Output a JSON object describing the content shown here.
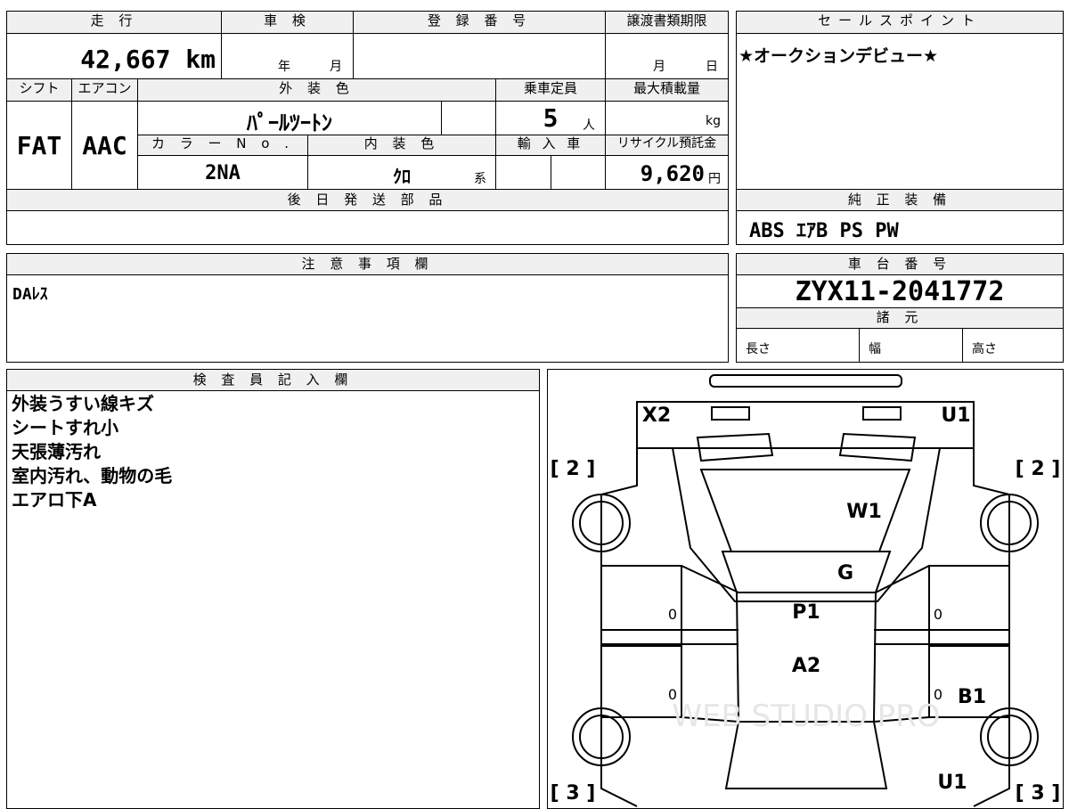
{
  "vehicle": {
    "mileage": {
      "label": "走 行",
      "value": "42,667 km"
    },
    "inspection": {
      "label": "車 検",
      "year_unit": "年",
      "month_unit": "月"
    },
    "registration": {
      "label": "登 録 番 号",
      "value": ""
    },
    "transfer_deadline": {
      "label": "譲渡書類期限",
      "month_unit": "月",
      "day_unit": "日"
    },
    "shift": {
      "label": "シフト",
      "value": "FAT"
    },
    "aircon": {
      "label": "エアコン",
      "value": "AAC"
    },
    "exterior_color": {
      "label": "外 装 色",
      "value": "ﾊﾟｰﾙﾂｰﾄﾝ"
    },
    "capacity": {
      "label": "乗車定員",
      "value": "5",
      "unit": "人"
    },
    "max_load": {
      "label": "最大積載量",
      "unit": "kg"
    },
    "color_no": {
      "label": "カ ラ ー N o .",
      "value": "2NA"
    },
    "interior_color": {
      "label": "内 装 色",
      "value": "ｸﾛ",
      "unit": "系"
    },
    "import": {
      "label": "輸 入 車"
    },
    "recycle_fee": {
      "label": "リサイクル預託金",
      "value": "9,620",
      "unit": "円"
    },
    "later_parts": {
      "label": "後 日 発 送 部 品"
    }
  },
  "sales_point": {
    "label": "セールスポイント",
    "text": "★オークションデビュー★"
  },
  "genuine_equipment": {
    "label": "純 正 装 備",
    "value": "ABS ｴｱB PS PW"
  },
  "notes": {
    "label": "注 意 事 項 欄",
    "text": "DAﾚｽ"
  },
  "chassis": {
    "label": "車 台 番 号",
    "value": "ZYX11-2041772"
  },
  "specs": {
    "label": "諸 元",
    "length": "長さ",
    "width": "幅",
    "height": "高さ"
  },
  "inspector": {
    "label": "検 査 員 記 入 欄",
    "lines": [
      "外装うすい線キズ",
      "シートすれ小",
      "天張薄汚れ",
      "室内汚れ、動物の毛",
      "エアロ下A"
    ]
  },
  "diagram": {
    "marks": [
      "X2",
      "U1",
      "W1",
      "G",
      "P1",
      "A2",
      "B1",
      "U1"
    ],
    "tires": [
      "[ 2 ]",
      "[ 2 ]",
      "[ 3 ]",
      "[ 3 ]"
    ],
    "zeros": [
      "0",
      "0",
      "0",
      "0"
    ],
    "watermark": "WEB STUDIO PRO"
  }
}
